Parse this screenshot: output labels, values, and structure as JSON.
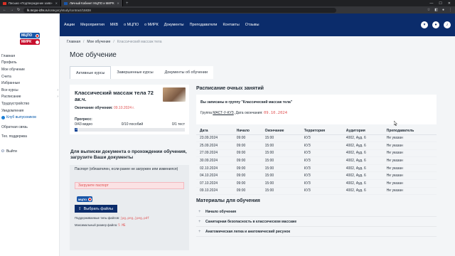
{
  "browser": {
    "tabs": [
      {
        "title": "Письмо «Подтверждение заяв»",
        "active": false
      },
      {
        "title": "Личный Кабинет МЦПО и МИРК",
        "active": true
      }
    ],
    "new_tab": "+",
    "url_host": "lk.mcpo-izhs.ru",
    "url_path": "/category/study/contract/15838"
  },
  "sidebar": {
    "logos": [
      "МЦПО",
      "МИРК"
    ],
    "items": [
      {
        "label": "Главная",
        "chevron": false
      },
      {
        "label": "Профиль",
        "chevron": false
      },
      {
        "label": "Мое обучение",
        "chevron": false
      },
      {
        "label": "Счета",
        "chevron": false
      },
      {
        "label": "Избранные",
        "chevron": false
      },
      {
        "label": "Все курсы",
        "chevron": true
      },
      {
        "label": "Расписание",
        "chevron": true
      },
      {
        "label": "Трудоустройство",
        "chevron": false
      },
      {
        "label": "Уведомления",
        "chevron": false
      }
    ],
    "club": "Клуб выпускников",
    "items2": [
      {
        "label": "Обратная связь"
      },
      {
        "label": "Тех. поддержка"
      }
    ],
    "logout": "Выйти"
  },
  "topnav": {
    "links": [
      "Акции",
      "Мероприятия",
      "МКВ",
      "о МЦПО",
      "о МИРК",
      "Документы",
      "Преподаватели",
      "Контакты",
      "Отзывы"
    ]
  },
  "breadcrumb": [
    "Главная",
    "Мое обучение",
    "Классический массаж тела"
  ],
  "page_title": "Мое обучение",
  "tabs": [
    "Активные курсы",
    "Завершенные курсы",
    "Документы об обучении"
  ],
  "course": {
    "title": "Классический массаж тела 72 ак.ч.",
    "end_label": "Окончание обучения:",
    "end_date": "09.10.2024 г.",
    "progress_label": "Прогресс:",
    "stats": [
      "0/43 видео",
      "0/10 пособий",
      "0/1 тест"
    ],
    "progress_value": 0,
    "progress_text": "0%"
  },
  "upload": {
    "heading": "Для выписки документа о прохождении обучения, загрузите Ваши документы",
    "passport_label": "Паспорт (обязателен, если ранее не загружен или изменился)",
    "alert": "Загрузите паспорт",
    "mini_logo": "МЦПО",
    "button": "Выбрать файлы",
    "types_label": "Поддерживаемые типы файлов:",
    "types": "jpg,png,jpeg,pdf",
    "size_label": "Максимальный размер файла:",
    "size": "5 МБ"
  },
  "schedule": {
    "heading": "Расписание очных занятий",
    "enrolled": "Вы записаны в группу \"Классический массаж тела\"",
    "group_label": "Группа",
    "group_code": "МАСТ-У-КУЗ",
    "end_label": ", Дата окончания:",
    "end_date": "09.10.2024",
    "columns": [
      "Дата",
      "Начало",
      "Окончание",
      "Территория",
      "Аудитория",
      "Преподаватель"
    ],
    "rows": [
      [
        "23.09.2024",
        "09:00",
        "15:00",
        "КУЗ",
        "4002, Ауд. 6",
        "Не указан"
      ],
      [
        "25.09.2024",
        "09:00",
        "15:00",
        "КУЗ",
        "4002, Ауд. 6",
        "Не указан"
      ],
      [
        "27.09.2024",
        "09:00",
        "15:00",
        "КУЗ",
        "4002, Ауд. 6",
        "Не указан"
      ],
      [
        "30.09.2024",
        "09:00",
        "15:00",
        "КУЗ",
        "4002, Ауд. 6",
        "Не указан"
      ],
      [
        "02.10.2024",
        "09:00",
        "15:00",
        "КУЗ",
        "4002, Ауд. 6",
        "Не указан"
      ],
      [
        "04.10.2024",
        "09:00",
        "15:00",
        "КУЗ",
        "4002, Ауд. 6",
        "Не указан"
      ],
      [
        "07.10.2024",
        "09:00",
        "15:00",
        "КУЗ",
        "4002, Ауд. 6",
        "Не указан"
      ],
      [
        "09.10.2024",
        "09:00",
        "15:00",
        "КУЗ",
        "4002, Ауд. 6",
        "Не указан"
      ]
    ]
  },
  "materials": {
    "heading": "Материалы для обучения",
    "items": [
      "Начало обучения",
      "Санитарная безопасность в классическом массаже",
      "Анатомическая лепка и анатомический рисунок"
    ]
  },
  "colors": {
    "navy": "#0b2c6b",
    "accent_red": "#e05252",
    "link_blue": "#0b5cad"
  }
}
